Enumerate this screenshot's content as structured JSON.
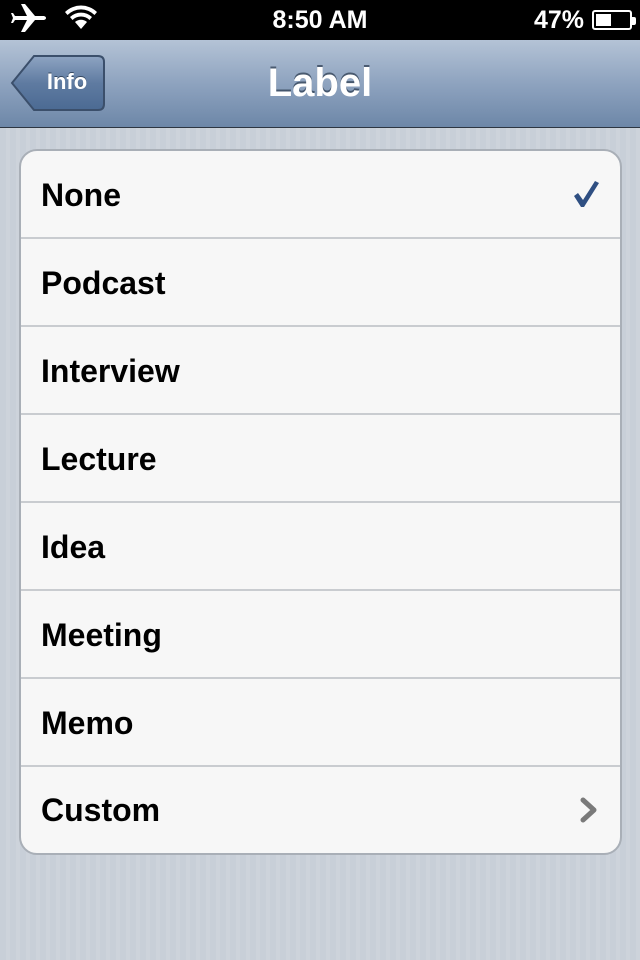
{
  "status_bar": {
    "time": "8:50 AM",
    "battery_percent": "47%",
    "battery_level": 0.47,
    "icons": [
      "airplane-icon",
      "wifi-icon",
      "battery-icon"
    ]
  },
  "nav": {
    "back_label": "Info",
    "title": "Label"
  },
  "options": [
    {
      "label": "None",
      "selected": true,
      "accessory": "checkmark-icon"
    },
    {
      "label": "Podcast"
    },
    {
      "label": "Interview"
    },
    {
      "label": "Lecture"
    },
    {
      "label": "Idea"
    },
    {
      "label": "Meeting"
    },
    {
      "label": "Memo"
    },
    {
      "label": "Custom",
      "accessory": "chevron-right-icon"
    }
  ],
  "colors": {
    "checkmark": "#2f4f82",
    "nav_gradient_top": "#b4c3d6",
    "nav_gradient_bottom": "#6d87a8"
  }
}
